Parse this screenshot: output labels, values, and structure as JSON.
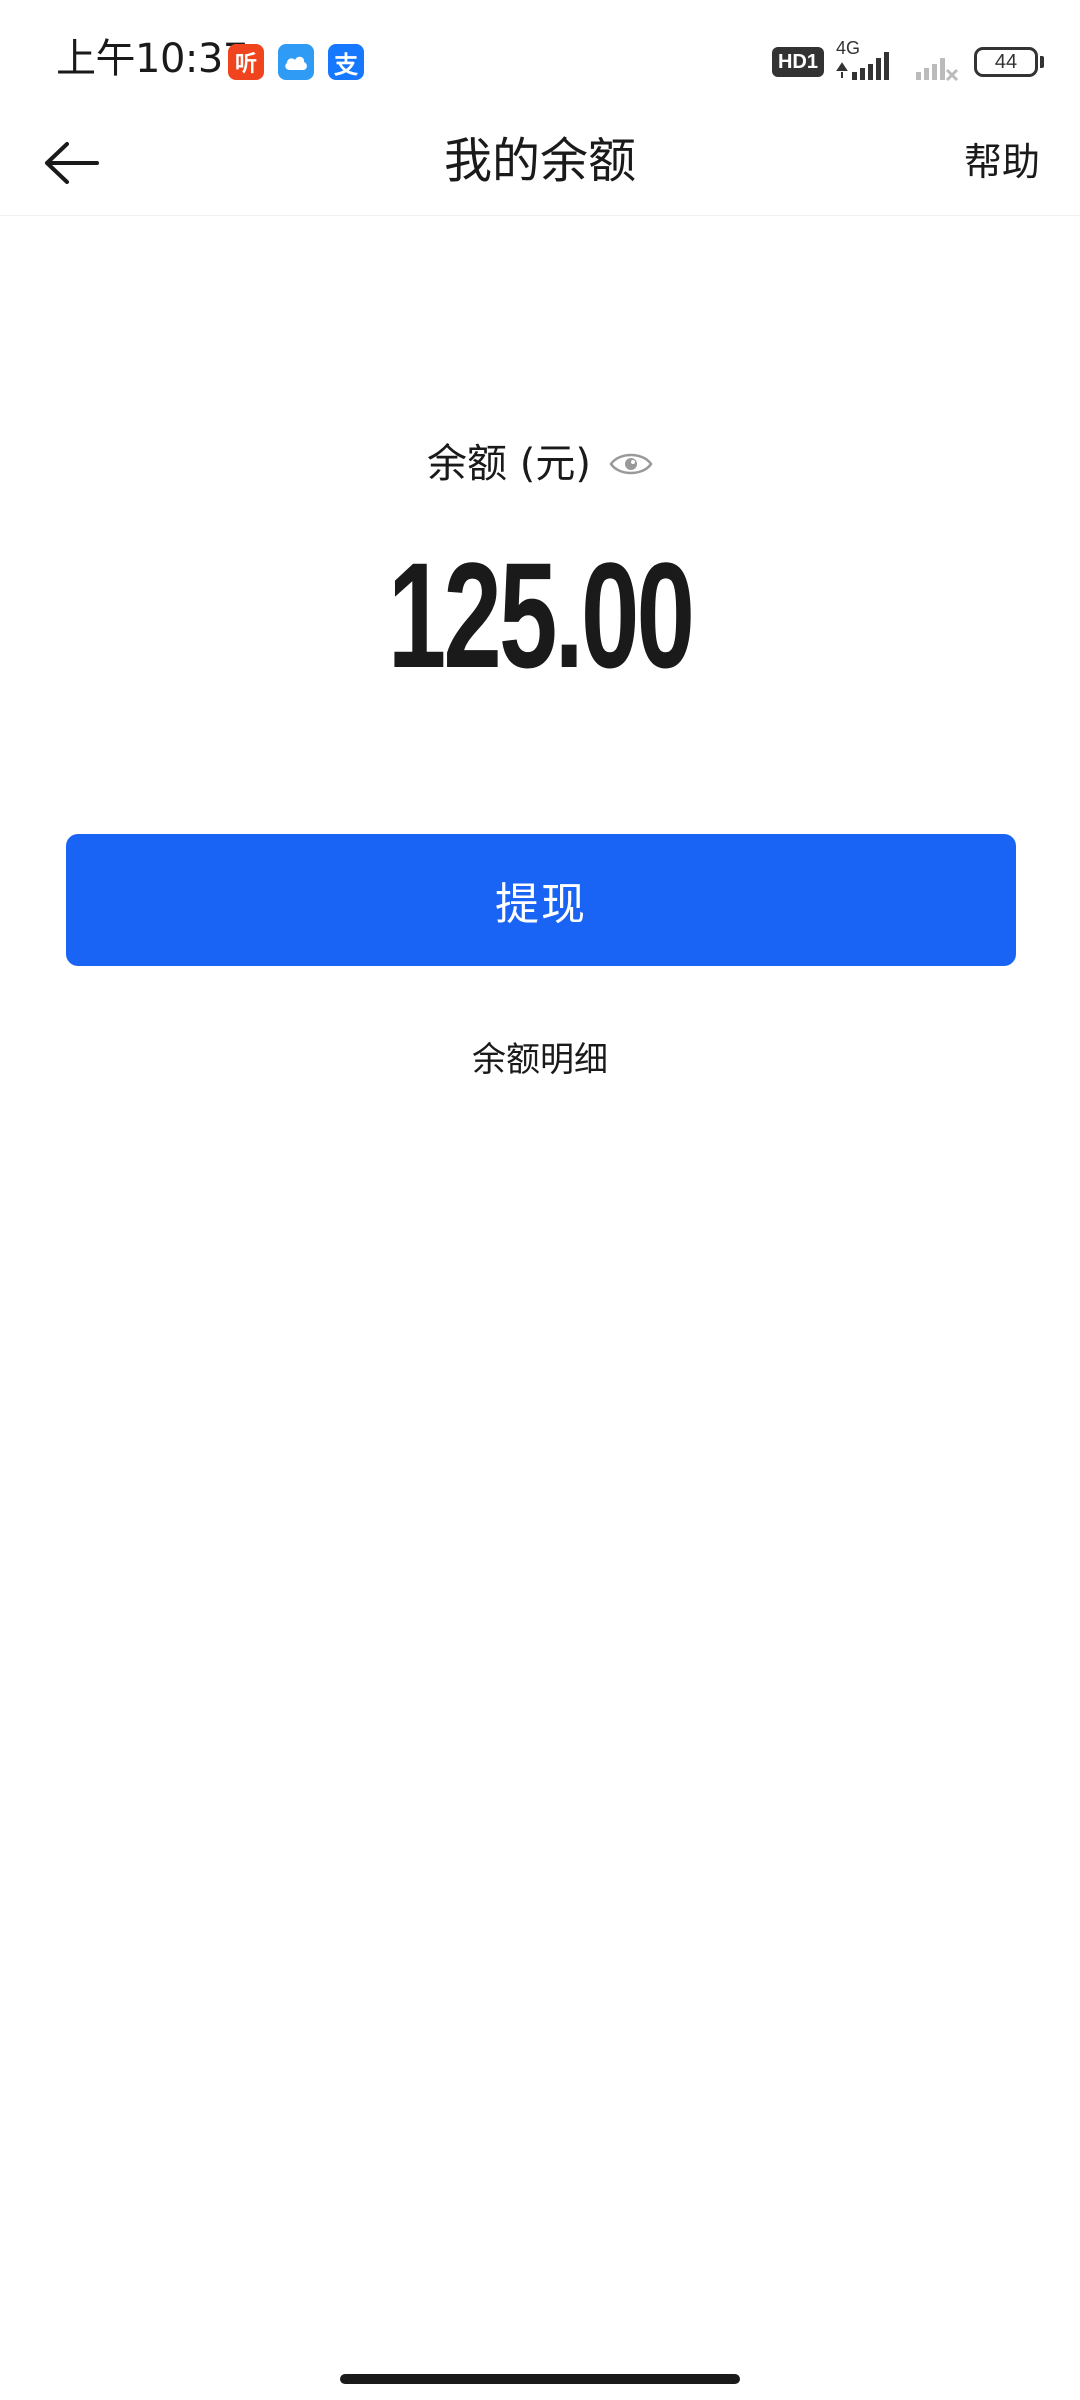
{
  "status_bar": {
    "time": "上午10:37",
    "notifications": [
      {
        "name": "listen-app-icon",
        "glyph": "听",
        "color": "#f0441f"
      },
      {
        "name": "cloud-app-icon",
        "glyph": "",
        "color": "#2f9bf5"
      },
      {
        "name": "alipay-app-icon",
        "glyph": "支",
        "color": "#1677ff"
      }
    ],
    "hd_label": "HD1",
    "network_label": "4G",
    "battery": "44"
  },
  "header": {
    "title": "我的余额",
    "help_label": "帮助"
  },
  "balance": {
    "label": "余额 (元)",
    "amount": "125.00"
  },
  "actions": {
    "withdraw_label": "提现",
    "detail_label": "余额明细"
  },
  "colors": {
    "primary": "#1a64f5",
    "text": "#1a1a1a"
  }
}
